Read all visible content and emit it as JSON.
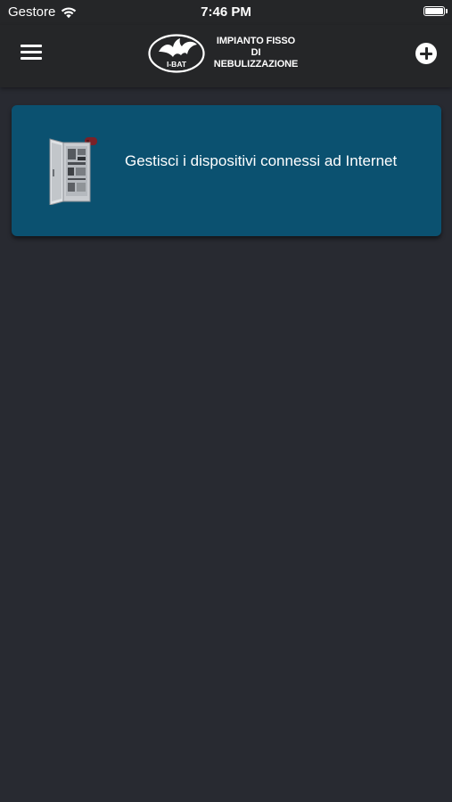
{
  "status_bar": {
    "carrier": "Gestore",
    "time": "7:46 PM"
  },
  "header": {
    "logo_badge": "I-BAT",
    "title_lines": [
      "IMPIANTO FISSO",
      "DI",
      "NEBULIZZAZIONE"
    ]
  },
  "device_card": {
    "label": "Gestisci i dispositivi connessi ad Internet",
    "image": "control-cabinet-image"
  },
  "colors": {
    "background": "#282a31",
    "nav_background": "#252628",
    "card_background": "#0b5170",
    "text": "#ffffff"
  }
}
